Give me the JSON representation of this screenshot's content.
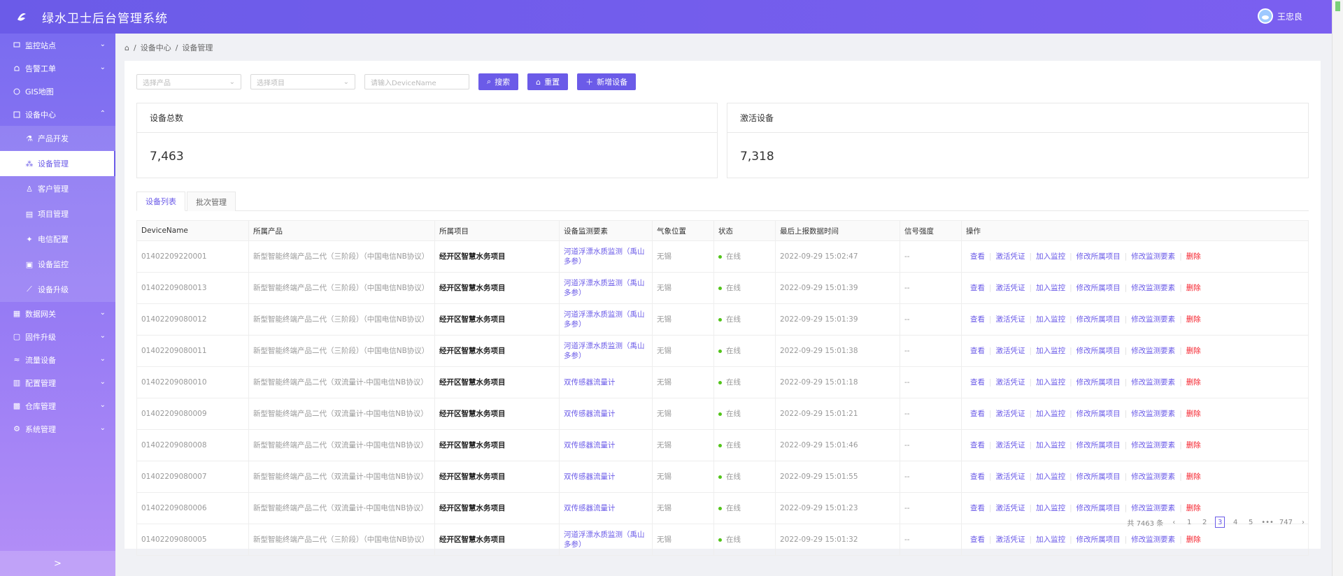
{
  "app": {
    "title": "绿水卫士后台管理系统",
    "user": "王忠良"
  },
  "sidebar": {
    "items": [
      {
        "label": "监控站点",
        "icon": "monitor-icon"
      },
      {
        "label": "告警工单",
        "icon": "alarm-icon"
      },
      {
        "label": "GIS地图",
        "icon": "globe-icon"
      },
      {
        "label": "设备中心",
        "icon": "device-icon"
      }
    ],
    "sub": [
      {
        "label": "产品开发"
      },
      {
        "label": "设备管理"
      },
      {
        "label": "客户管理"
      },
      {
        "label": "项目管理"
      },
      {
        "label": "电信配置"
      },
      {
        "label": "设备监控"
      },
      {
        "label": "设备升级"
      }
    ],
    "items2": [
      {
        "label": "数据网关"
      },
      {
        "label": "固件升级"
      },
      {
        "label": "流量设备"
      },
      {
        "label": "配置管理"
      },
      {
        "label": "仓库管理"
      },
      {
        "label": "系统管理"
      }
    ],
    "collapse": ">"
  },
  "breadcrumb": {
    "home": "⌂",
    "sep": "/",
    "level1": "设备中心",
    "level2": "设备管理"
  },
  "filter": {
    "product_placeholder": "选择产品",
    "project_placeholder": "选择项目",
    "device_placeholder": "请输入DeviceName",
    "search": "搜索",
    "reset": "重置",
    "add": "新增设备"
  },
  "stats": {
    "total_label": "设备总数",
    "total_value": "7,463",
    "active_label": "激活设备",
    "active_value": "7,318"
  },
  "tabs": [
    "设备列表",
    "批次管理"
  ],
  "table": {
    "headers": [
      "DeviceName",
      "所属产品",
      "所属项目",
      "设备监测要素",
      "气象位置",
      "状态",
      "最后上报数据时间",
      "信号强度",
      "操作"
    ],
    "ops": [
      "查看",
      "激活凭证",
      "加入监控",
      "修改所属项目",
      "修改监测要素",
      "删除"
    ],
    "rows": [
      {
        "name": "01402209220001",
        "product": "新型智能终端产品二代（三阶段）（中国电信NB协议）",
        "project": "经开区智慧水务项目",
        "element": "河道浮漂水质监测（禹山多参）",
        "loc": "无锡",
        "status": "在线",
        "time": "2022-09-29 15:02:47",
        "signal": "--"
      },
      {
        "name": "01402209080013",
        "product": "新型智能终端产品二代（三阶段）（中国电信NB协议）",
        "project": "经开区智慧水务项目",
        "element": "河道浮漂水质监测（禹山多参）",
        "loc": "无锡",
        "status": "在线",
        "time": "2022-09-29 15:01:39",
        "signal": "--"
      },
      {
        "name": "01402209080012",
        "product": "新型智能终端产品二代（三阶段）（中国电信NB协议）",
        "project": "经开区智慧水务项目",
        "element": "河道浮漂水质监测（禹山多参）",
        "loc": "无锡",
        "status": "在线",
        "time": "2022-09-29 15:01:39",
        "signal": "--"
      },
      {
        "name": "01402209080011",
        "product": "新型智能终端产品二代（三阶段）（中国电信NB协议）",
        "project": "经开区智慧水务项目",
        "element": "河道浮漂水质监测（禹山多参）",
        "loc": "无锡",
        "status": "在线",
        "time": "2022-09-29 15:01:38",
        "signal": "--"
      },
      {
        "name": "01402209080010",
        "product": "新型智能终端产品二代（双流量计-中国电信NB协议）",
        "project": "经开区智慧水务项目",
        "element": "双传感器流量计",
        "loc": "无锡",
        "status": "在线",
        "time": "2022-09-29 15:01:18",
        "signal": "--"
      },
      {
        "name": "01402209080009",
        "product": "新型智能终端产品二代（双流量计-中国电信NB协议）",
        "project": "经开区智慧水务项目",
        "element": "双传感器流量计",
        "loc": "无锡",
        "status": "在线",
        "time": "2022-09-29 15:01:21",
        "signal": "--"
      },
      {
        "name": "01402209080008",
        "product": "新型智能终端产品二代（双流量计-中国电信NB协议）",
        "project": "经开区智慧水务项目",
        "element": "双传感器流量计",
        "loc": "无锡",
        "status": "在线",
        "time": "2022-09-29 15:01:46",
        "signal": "--"
      },
      {
        "name": "01402209080007",
        "product": "新型智能终端产品二代（双流量计-中国电信NB协议）",
        "project": "经开区智慧水务项目",
        "element": "双传感器流量计",
        "loc": "无锡",
        "status": "在线",
        "time": "2022-09-29 15:01:55",
        "signal": "--"
      },
      {
        "name": "01402209080006",
        "product": "新型智能终端产品二代（双流量计-中国电信NB协议）",
        "project": "经开区智慧水务项目",
        "element": "双传感器流量计",
        "loc": "无锡",
        "status": "在线",
        "time": "2022-09-29 15:01:23",
        "signal": "--"
      },
      {
        "name": "01402209080005",
        "product": "新型智能终端产品二代（三阶段）（中国电信NB协议）",
        "project": "经开区智慧水务项目",
        "element": "河道浮漂水质监测（禹山多参）",
        "loc": "无锡",
        "status": "在线",
        "time": "2022-09-29 15:01:32",
        "signal": "--"
      }
    ]
  },
  "pagination": {
    "total": "共 7463 条",
    "prev": "‹",
    "pages": [
      "1",
      "2",
      "3",
      "4",
      "5",
      "•••",
      "747"
    ],
    "current": "3",
    "next": "›"
  },
  "colors": {
    "accent": "#6b5be8",
    "online": "#52c41a",
    "danger": "#f5222d"
  }
}
